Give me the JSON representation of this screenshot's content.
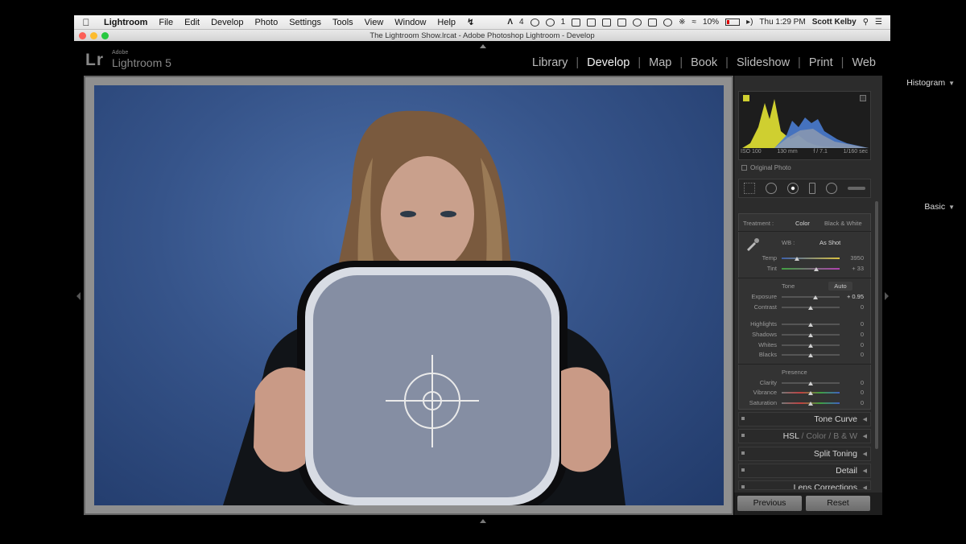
{
  "menubar": {
    "app": "Lightroom",
    "menus": [
      "File",
      "Edit",
      "Develop",
      "Photo",
      "Settings",
      "Tools",
      "View",
      "Window",
      "Help"
    ],
    "status_num": "4",
    "status_num2": "1",
    "battery": "10%",
    "clock": "Thu 1:29 PM",
    "user": "Scott Kelby"
  },
  "window": {
    "title": "The Lightroom Show.lrcat - Adobe Photoshop Lightroom - Develop"
  },
  "lr": {
    "logo_lr": "Lr",
    "logo_adobe": "Adobe",
    "logo_name": "Lightroom 5",
    "modules": [
      "Library",
      "Develop",
      "Map",
      "Book",
      "Slideshow",
      "Print",
      "Web"
    ],
    "active_module": "Develop"
  },
  "histogram": {
    "title": "Histogram",
    "iso": "ISO 100",
    "focal": "130 mm",
    "aperture": "f / 7.1",
    "shutter": "1/160 sec",
    "original_photo": "Original Photo"
  },
  "basic": {
    "title": "Basic",
    "treatment_label": "Treatment :",
    "treatment_color": "Color",
    "treatment_bw": "Black & White",
    "wb_label": "WB :",
    "wb_value": "As Shot",
    "sliders_wb": [
      {
        "label": "Temp",
        "value": "3950",
        "pos": 0.26
      },
      {
        "label": "Tint",
        "value": "+ 33",
        "pos": 0.6
      }
    ],
    "tone_label": "Tone",
    "auto_label": "Auto",
    "sliders_tone": [
      {
        "label": "Exposure",
        "value": "+ 0.95",
        "pos": 0.58
      },
      {
        "label": "Contrast",
        "value": "0",
        "pos": 0.5
      }
    ],
    "sliders_tone2": [
      {
        "label": "Highlights",
        "value": "0",
        "pos": 0.5
      },
      {
        "label": "Shadows",
        "value": "0",
        "pos": 0.5
      },
      {
        "label": "Whites",
        "value": "0",
        "pos": 0.5
      },
      {
        "label": "Blacks",
        "value": "0",
        "pos": 0.5
      }
    ],
    "presence_label": "Presence",
    "sliders_presence": [
      {
        "label": "Clarity",
        "value": "0",
        "pos": 0.5
      },
      {
        "label": "Vibrance",
        "value": "0",
        "pos": 0.5
      },
      {
        "label": "Saturation",
        "value": "0",
        "pos": 0.5
      }
    ]
  },
  "sections": {
    "tone_curve": "Tone Curve",
    "hsl": "HSL",
    "hsl_sep": "/",
    "hsl_color": "Color",
    "hsl_bw": "B & W",
    "split_toning": "Split Toning",
    "detail": "Detail",
    "lens_corrections": "Lens Corrections"
  },
  "buttons": {
    "previous": "Previous",
    "reset": "Reset"
  },
  "colors": {
    "accent_active": "#f2f2f2",
    "panel_bg": "#2c2c2c",
    "backdrop_blue": "#36548a"
  }
}
